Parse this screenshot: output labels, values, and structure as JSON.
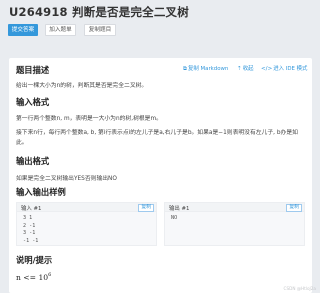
{
  "header": {
    "title": "U264918 判断是否是完全二叉树",
    "buttons": {
      "submit": "提交答案",
      "add_list": "加入题单",
      "copy_problem": "复制题目"
    }
  },
  "toolbar": {
    "copy_markdown": "复制 Markdown",
    "collapse": "收起",
    "ide_mode": "进入 IDE 模式"
  },
  "sections": {
    "description": {
      "heading": "题目描述",
      "text": "给出一棵大小为n的树，判断其是否是完全二叉树。"
    },
    "input_format": {
      "heading": "输入格式",
      "line1": "第一行两个整数n, m，表明是一大小为n的树,树根是m。",
      "line2": "接下来n行，每行两个整数a, b, 第i行表示点i的左儿子是a,右儿子是b。如果a是−1则表明没有左儿子, b办是如此。"
    },
    "output_format": {
      "heading": "输出格式",
      "text": "如果是完全二叉树输出YES否则输出NO"
    },
    "samples": {
      "heading": "输入输出样例",
      "input_label": "输入 #1",
      "output_label": "输出 #1",
      "copy_label": "复制",
      "input_lines": "3 1\n2 -1\n3 -1\n-1 -1",
      "output_lines": "NO"
    },
    "hint": {
      "heading": "说明/提示",
      "math_text": "n <= 10",
      "math_exp": "6"
    }
  },
  "watermark": "CSDN @HtloJ2a",
  "colors": {
    "accent": "#3498db",
    "page_bg": "#e9ecf0",
    "card_bg": "#ffffff"
  }
}
